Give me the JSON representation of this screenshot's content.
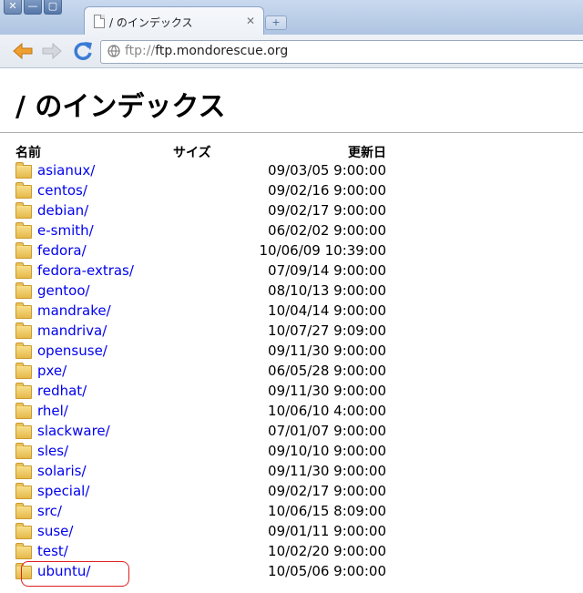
{
  "window": {
    "buttons": {
      "close": "✕",
      "minimize": "—",
      "maximize": "▢"
    },
    "tab_title": "/ のインデックス",
    "tab_close": "✕",
    "new_tab": "+"
  },
  "toolbar": {
    "url_scheme": "ftp://",
    "url_host": "ftp.mondorescue.org"
  },
  "page": {
    "heading": "/ のインデックス",
    "columns": {
      "name": "名前",
      "size": "サイズ",
      "modified": "更新日"
    },
    "entries": [
      {
        "name": "asianux/",
        "date": "09/03/05 9:00:00"
      },
      {
        "name": "centos/",
        "date": "09/02/16 9:00:00"
      },
      {
        "name": "debian/",
        "date": "09/02/17 9:00:00"
      },
      {
        "name": "e-smith/",
        "date": "06/02/02 9:00:00"
      },
      {
        "name": "fedora/",
        "date": "10/06/09 10:39:00"
      },
      {
        "name": "fedora-extras/",
        "date": "07/09/14 9:00:00"
      },
      {
        "name": "gentoo/",
        "date": "08/10/13 9:00:00"
      },
      {
        "name": "mandrake/",
        "date": "10/04/14 9:00:00"
      },
      {
        "name": "mandriva/",
        "date": "10/07/27 9:09:00"
      },
      {
        "name": "opensuse/",
        "date": "09/11/30 9:00:00"
      },
      {
        "name": "pxe/",
        "date": "06/05/28 9:00:00"
      },
      {
        "name": "redhat/",
        "date": "09/11/30 9:00:00"
      },
      {
        "name": "rhel/",
        "date": "10/06/10 4:00:00"
      },
      {
        "name": "slackware/",
        "date": "07/01/07 9:00:00"
      },
      {
        "name": "sles/",
        "date": "09/10/10 9:00:00"
      },
      {
        "name": "solaris/",
        "date": "09/11/30 9:00:00"
      },
      {
        "name": "special/",
        "date": "09/02/17 9:00:00"
      },
      {
        "name": "src/",
        "date": "10/06/15 8:09:00"
      },
      {
        "name": "suse/",
        "date": "09/01/11 9:00:00"
      },
      {
        "name": "test/",
        "date": "10/02/20 9:00:00"
      },
      {
        "name": "ubuntu/",
        "date": "10/05/06 9:00:00"
      }
    ]
  },
  "colors": {
    "link": "#0000ee",
    "highlight": "#e02020"
  }
}
